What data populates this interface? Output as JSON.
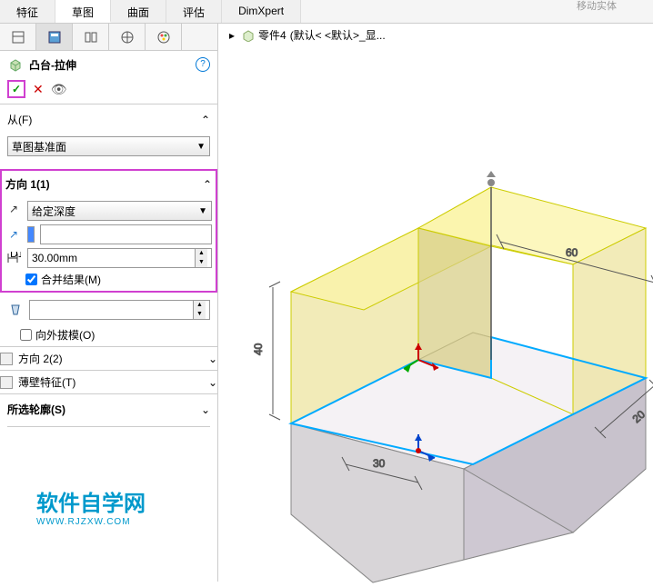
{
  "top_menu_hint": "移动实体",
  "ribbon_tabs": [
    "特征",
    "草图",
    "曲面",
    "评估",
    "DimXpert"
  ],
  "ribbon_active_index": 1,
  "breadcrumb": {
    "part": "零件4",
    "config": "(默认< <默认>_显..."
  },
  "feature": {
    "icon_name": "extrude-icon",
    "title": "凸台-拉伸"
  },
  "from_section": {
    "label": "从(F)",
    "plane_dropdown": "草图基准面"
  },
  "dir1": {
    "label": "方向 1(1)",
    "end_condition": "给定深度",
    "depth_value": "30.00mm",
    "merge_label": "合并结果(M)",
    "merge_checked": true,
    "draft_label": "向外拔模(O)",
    "draft_checked": false
  },
  "dir2_label": "方向 2(2)",
  "thin_label": "薄壁特征(T)",
  "contours_label": "所选轮廓(S)",
  "watermark": {
    "text": "软件自学网",
    "url": "WWW.RJZXW.COM"
  },
  "dims": {
    "d40": "40",
    "d60": "60",
    "d30": "30",
    "d20": "20"
  },
  "chart_data": null
}
